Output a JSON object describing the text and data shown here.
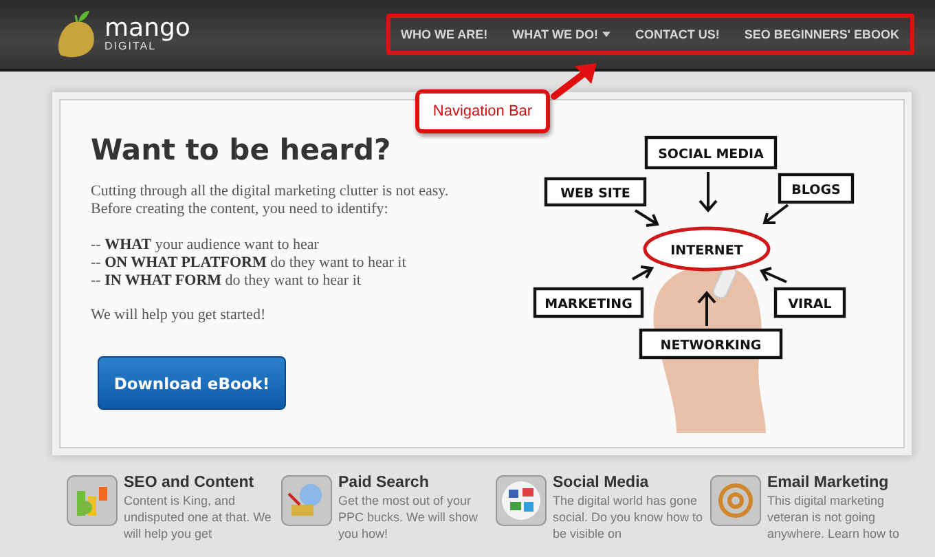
{
  "header": {
    "logo": {
      "name": "mango",
      "tagline": "DIGITAL"
    },
    "nav": [
      {
        "label": "WHO WE ARE!",
        "dropdown": false
      },
      {
        "label": "WHAT WE DO!",
        "dropdown": true
      },
      {
        "label": "CONTACT US!",
        "dropdown": false
      },
      {
        "label": "SEO BEGINNERS' EBOOK",
        "dropdown": false
      }
    ]
  },
  "annotation": {
    "label": "Navigation Bar"
  },
  "hero": {
    "title": "Want to be heard?",
    "intro": "Cutting through all the digital marketing clutter is not easy. Before creating the content, you need to identify:",
    "points": [
      "-- **WHAT** your audience want to hear",
      "-- **ON WHAT PLATFORM** do they want to hear it",
      "-- **IN WHAT FORM** do they want to hear it"
    ],
    "closing": "We will help you get started!",
    "button": "Download eBook!",
    "diagram": {
      "center": "INTERNET",
      "nodes": [
        "SOCIAL MEDIA",
        "WEB SITE",
        "BLOGS",
        "MARKETING",
        "VIRAL",
        "NETWORKING"
      ]
    }
  },
  "features": [
    {
      "title": "SEO and Content",
      "text": "Content is King, and undisputed one at that. We will help you get"
    },
    {
      "title": "Paid Search",
      "text": "Get the most out of your PPC bucks. We will show you how!"
    },
    {
      "title": "Social Media",
      "text": "The digital world has gone social. Do you know how to be visible on"
    },
    {
      "title": "Email Marketing",
      "text": "This digital marketing veteran is not going anywhere. Learn how to"
    }
  ]
}
